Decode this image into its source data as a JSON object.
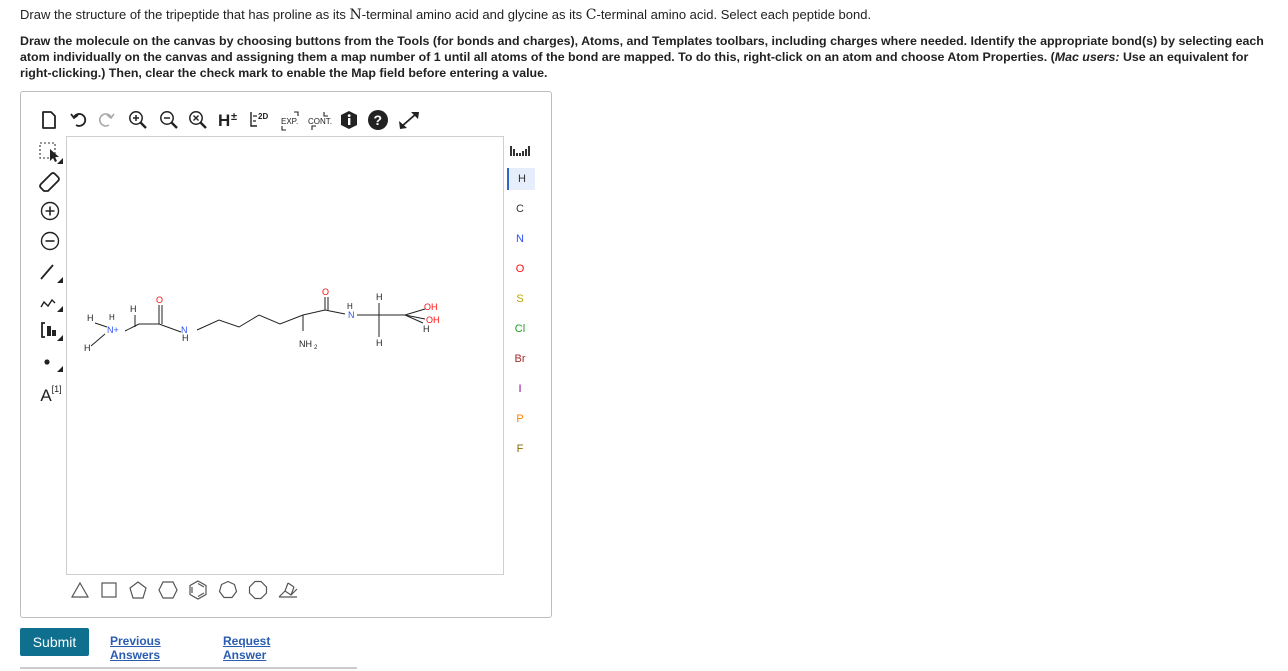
{
  "question": {
    "part1": "Draw the structure of the tripeptide that has proline as its ",
    "n_letter": "N",
    "part2": "-terminal amino acid and glycine as its ",
    "c_letter": "C",
    "part3": "-terminal amino acid. Select each peptide bond."
  },
  "instructions": {
    "main": "Draw the molecule on the canvas by choosing buttons from the Tools (for bonds and charges), Atoms, and Templates toolbars, including charges where needed. Identify the appropriate bond(s) by selecting each atom individually on the canvas and assigning them a map number of 1 until all atoms of the bond are mapped. To do this, right-click on an atom and choose Atom Properties. (",
    "mac": "Mac users:",
    "tail": " Use an equivalent for right-clicking.) Then, clear the check mark to enable the Map field before entering a value."
  },
  "toolbar": {
    "two_d_label": "2D",
    "exp_label": "EXP.",
    "cont_label": "CONT."
  },
  "left_tools": {
    "map_label": "A",
    "map_sup": "[1]"
  },
  "atoms": [
    "H",
    "C",
    "N",
    "O",
    "S",
    "Cl",
    "Br",
    "I",
    "P",
    "F"
  ],
  "atom_colors": {
    "H": "#333333",
    "C": "#333333",
    "N": "#3050f8",
    "O": "#ff0d0d",
    "S": "#b5a800",
    "Cl": "#1fa01f",
    "Br": "#a62929",
    "I": "#940094",
    "P": "#ff8000",
    "F": "#8a6d00"
  },
  "molecule": {
    "h": "H",
    "n": "N",
    "n_plus": "N+",
    "o": "O",
    "oh": "OH",
    "nh2": "NH",
    "nh2_sub": "2"
  },
  "footer": {
    "submit": "Submit",
    "previous": "Previous Answers",
    "request": "Request Answer"
  }
}
